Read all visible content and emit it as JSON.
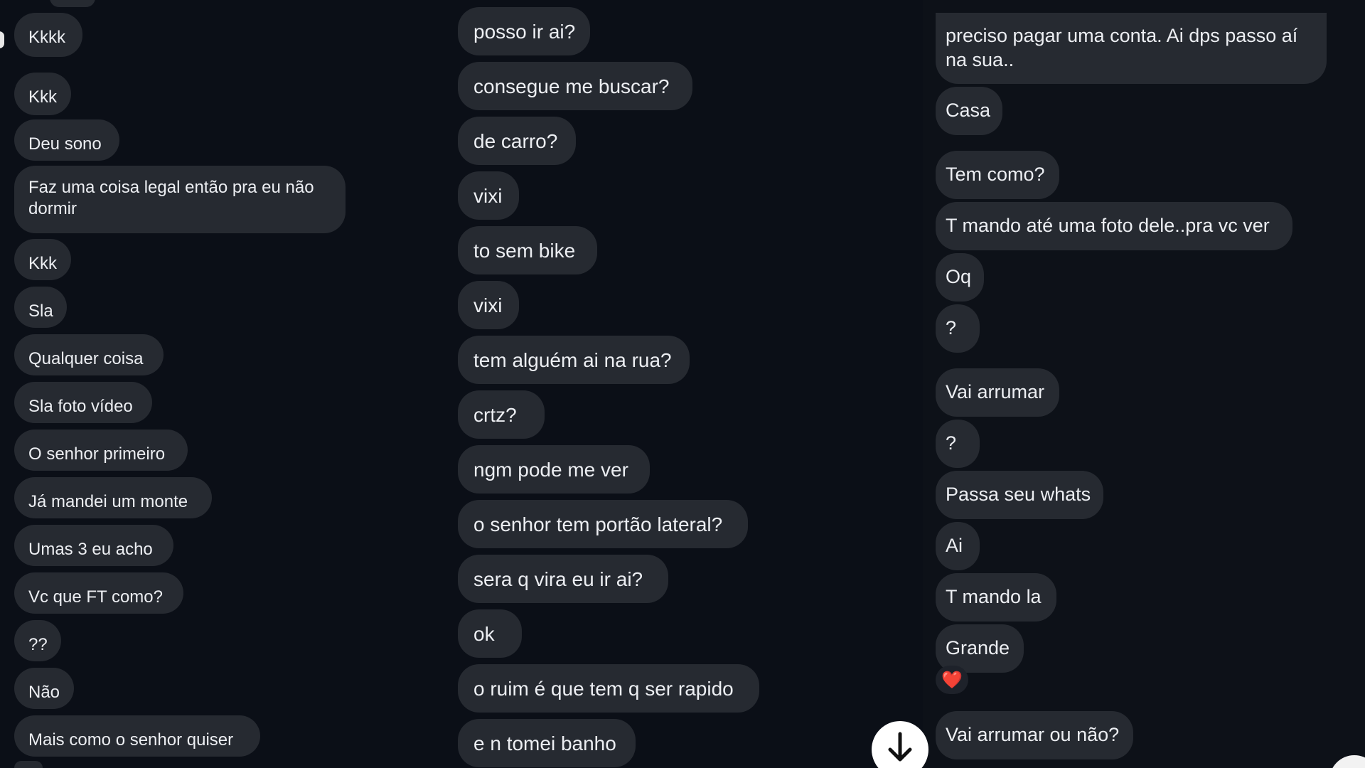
{
  "left_column": {
    "messages": [
      "Kkkk",
      "Kkk",
      "Deu sono",
      "Faz uma coisa legal então pra eu não dormir",
      "Kkk",
      "Sla",
      "Qualquer coisa",
      "Sla foto vídeo",
      "O senhor primeiro",
      "Já mandei um monte",
      "Umas 3 eu acho",
      "Vc que FT como?",
      "??",
      "Não",
      "Mais como o senhor quiser"
    ]
  },
  "middle_column": {
    "messages": [
      "posso ir ai?",
      "consegue me buscar?",
      "de carro?",
      "vixi",
      "to sem bike",
      "vixi",
      "tem alguém ai na rua?",
      "crtz?",
      "ngm pode me ver",
      "o senhor tem portão lateral?",
      "sera q vira eu ir ai?",
      "ok",
      "o ruim é que tem q ser rapido",
      "e n tomei banho"
    ]
  },
  "right_column": {
    "messages": [
      "preciso pagar uma conta. Ai dps passo aí na sua..",
      "Casa",
      "Tem como?",
      "T mando até uma foto dele..pra vc ver",
      "Oq",
      "?",
      "Vai arrumar",
      "?",
      "Passa seu whats",
      "Ai",
      "T mando la",
      "Grande",
      "Vai arrumar ou não?"
    ],
    "reaction": "❤️"
  },
  "icons": {
    "scroll_down": "arrow-down-icon"
  }
}
